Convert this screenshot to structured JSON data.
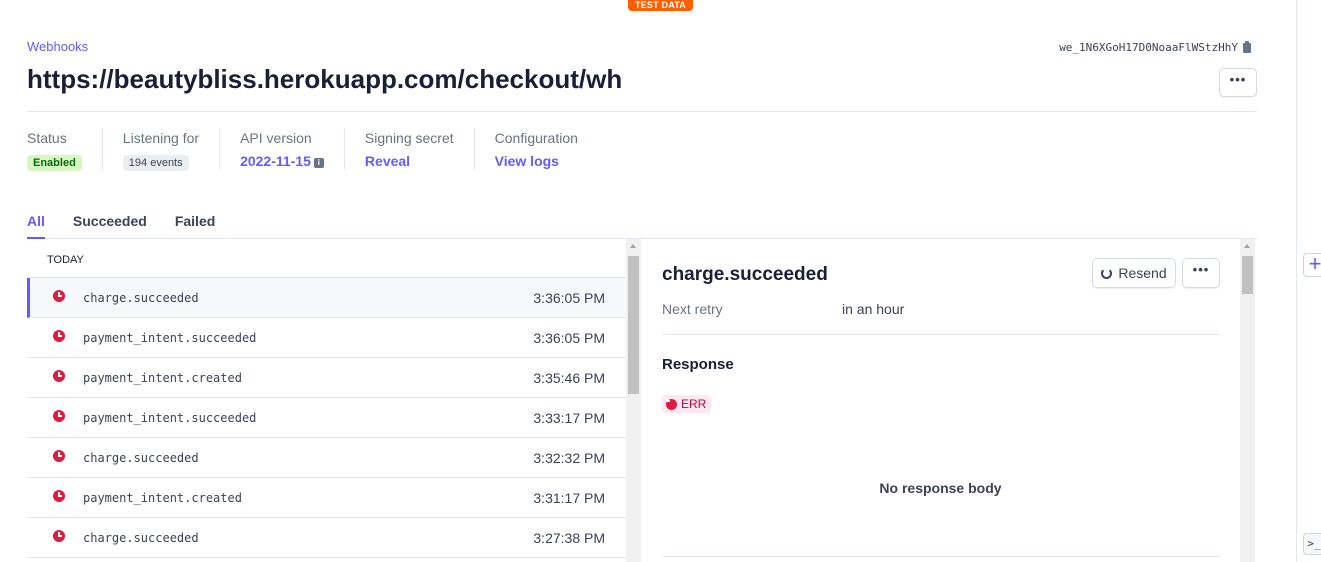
{
  "environment_badge": "TEST DATA",
  "breadcrumb": "Webhooks",
  "endpoint_id": "we_1N6XGoH17D0NoaaFlWStzHhY",
  "title": "https://beautybliss.herokuapp.com/checkout/wh",
  "meta": {
    "status_label": "Status",
    "status_value": "Enabled",
    "listening_label": "Listening for",
    "listening_value": "194 events",
    "api_label": "API version",
    "api_value": "2022-11-15",
    "secret_label": "Signing secret",
    "secret_value": "Reveal",
    "config_label": "Configuration",
    "config_value": "View logs"
  },
  "tabs": [
    "All",
    "Succeeded",
    "Failed"
  ],
  "list": {
    "section": "TODAY",
    "events": [
      {
        "name": "charge.succeeded",
        "time": "3:36:05 PM"
      },
      {
        "name": "payment_intent.succeeded",
        "time": "3:36:05 PM"
      },
      {
        "name": "payment_intent.created",
        "time": "3:35:46 PM"
      },
      {
        "name": "payment_intent.succeeded",
        "time": "3:33:17 PM"
      },
      {
        "name": "charge.succeeded",
        "time": "3:32:32 PM"
      },
      {
        "name": "payment_intent.created",
        "time": "3:31:17 PM"
      },
      {
        "name": "charge.succeeded",
        "time": "3:27:38 PM"
      }
    ]
  },
  "detail": {
    "title": "charge.succeeded",
    "resend_label": "Resend",
    "retry_label": "Next retry",
    "retry_value": "in an hour",
    "response_heading": "Response",
    "status_badge": "ERR",
    "empty_body": "No response body"
  },
  "colors": {
    "accent": "#635bff",
    "error": "#df1b41",
    "success_bg": "#d7f7c2",
    "test_badge": "#ff5f00"
  },
  "icons": [
    "copy-icon",
    "more-icon",
    "info-icon",
    "error-clock-icon",
    "resend-icon",
    "plus-icon",
    "terminal-icon"
  ]
}
